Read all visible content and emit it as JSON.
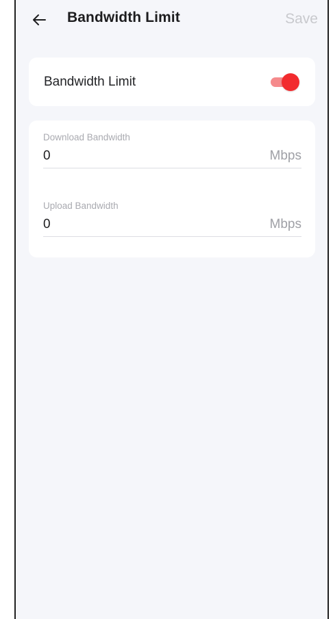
{
  "header": {
    "back_icon": "arrow-left-icon",
    "title": "Bandwidth Limit",
    "save_label": "Save"
  },
  "toggle_card": {
    "label": "Bandwidth Limit",
    "enabled": true,
    "accent_color": "#f22b2e"
  },
  "fields": {
    "download": {
      "label": "Download Bandwidth",
      "value": "0",
      "unit": "Mbps"
    },
    "upload": {
      "label": "Upload Bandwidth",
      "value": "0",
      "unit": "Mbps"
    }
  }
}
